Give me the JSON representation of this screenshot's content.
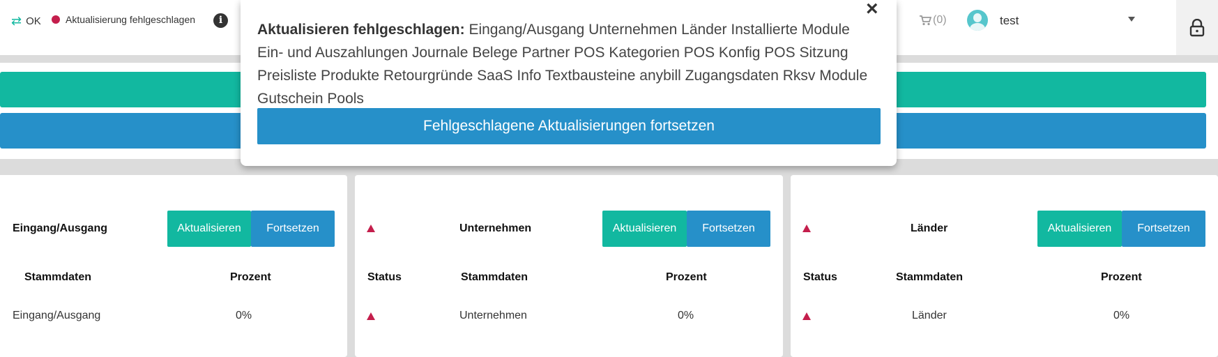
{
  "topbar": {
    "sync_label": "OK",
    "fail_label": "Aktualisierung fehlgeschlagen",
    "info_glyph": "i",
    "cart_count": "(0)",
    "user_name": "test"
  },
  "popup": {
    "title": "Aktualisieren fehlgeschlagen:",
    "failed_list": "Eingang/Ausgang Unternehmen Länder Installierte Module Ein- und Auszahlungen Journale Belege Partner POS Kategorien POS Konfig POS Sitzung Preisliste Produkte Retourgründe SaaS Info Textbausteine anybill Zugangsdaten Rksv Module Gutschein Pools",
    "continue_label": "Fehlgeschlagene Aktualisierungen fortsetzen",
    "close_glyph": "×"
  },
  "cards": [
    {
      "title": "Eingang/Ausgang",
      "update_label": "Aktualisieren",
      "continue_label": "Fortsetzen",
      "col_master": "Stammdaten",
      "col_percent": "Prozent",
      "row_master": "Eingang/Ausgang",
      "row_percent": "0%"
    },
    {
      "title": "Unternehmen",
      "update_label": "Aktualisieren",
      "continue_label": "Fortsetzen",
      "col_status": "Status",
      "col_master": "Stammdaten",
      "col_percent": "Prozent",
      "row_master": "Unternehmen",
      "row_percent": "0%"
    },
    {
      "title": "Länder",
      "update_label": "Aktualisieren",
      "continue_label": "Fortsetzen",
      "col_status": "Status",
      "col_master": "Stammdaten",
      "col_percent": "Prozent",
      "row_master": "Länder",
      "row_percent": "0%"
    }
  ],
  "colors": {
    "accent_green": "#12b8a0",
    "accent_blue": "#2690c9",
    "error_red": "#c41e4c"
  },
  "icons": [
    "sync-arrows-icon",
    "error-dot-icon",
    "info-icon",
    "cart-icon",
    "avatar-icon",
    "caret-down-icon",
    "lock-icon",
    "close-icon",
    "warning-triangle-icon"
  ]
}
